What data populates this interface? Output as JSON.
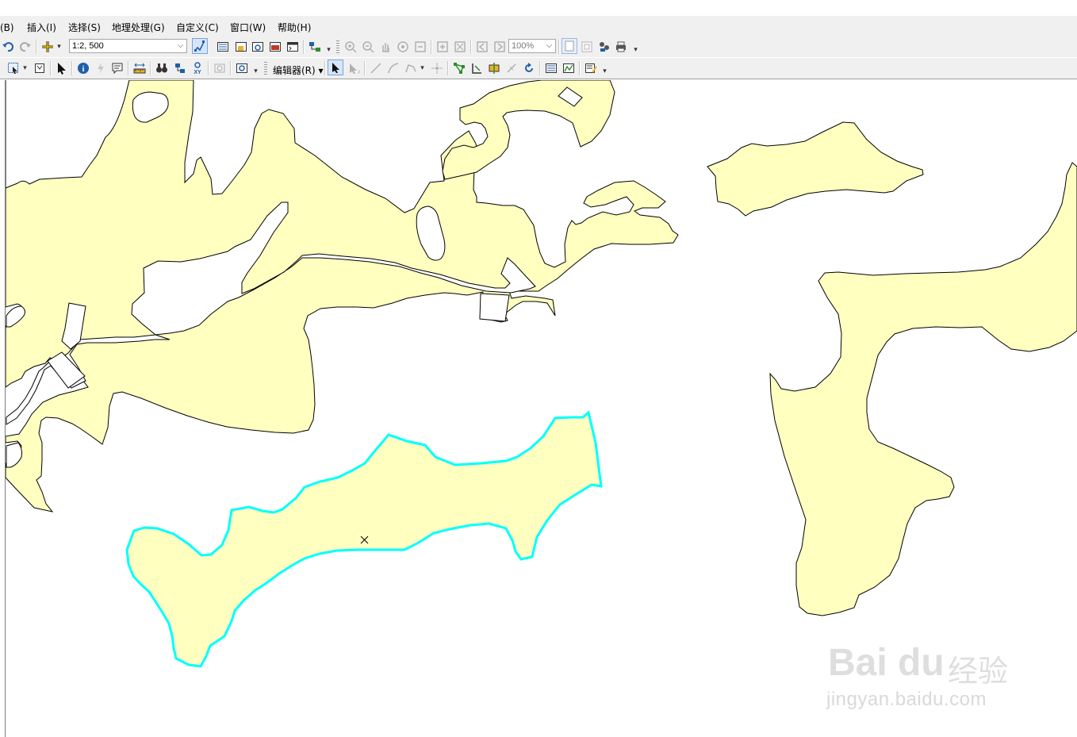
{
  "menus": [
    "视图(B)",
    "插入(I)",
    "选择(S)",
    "地理处理(G)",
    "自定义(C)",
    "窗口(W)",
    "帮助(H)"
  ],
  "menu_visible": [
    "度(B)",
    "插入(I)",
    "选择(S)",
    "地理处理(G)",
    "自定义(C)",
    "窗口(W)",
    "帮助(H)"
  ],
  "standard_toolbar": {
    "scale_value": "1:2, 500",
    "zoom_value": "100%"
  },
  "editor_toolbar": {
    "editor_menu_label": "编辑器(R)"
  },
  "map": {
    "feature_fill": "#ffffc0",
    "selection_color": "#00ffff",
    "background": "#ffffff"
  },
  "watermark": {
    "brand": "Bai du",
    "cn": "经验",
    "url": "jingyan.baidu.com"
  }
}
